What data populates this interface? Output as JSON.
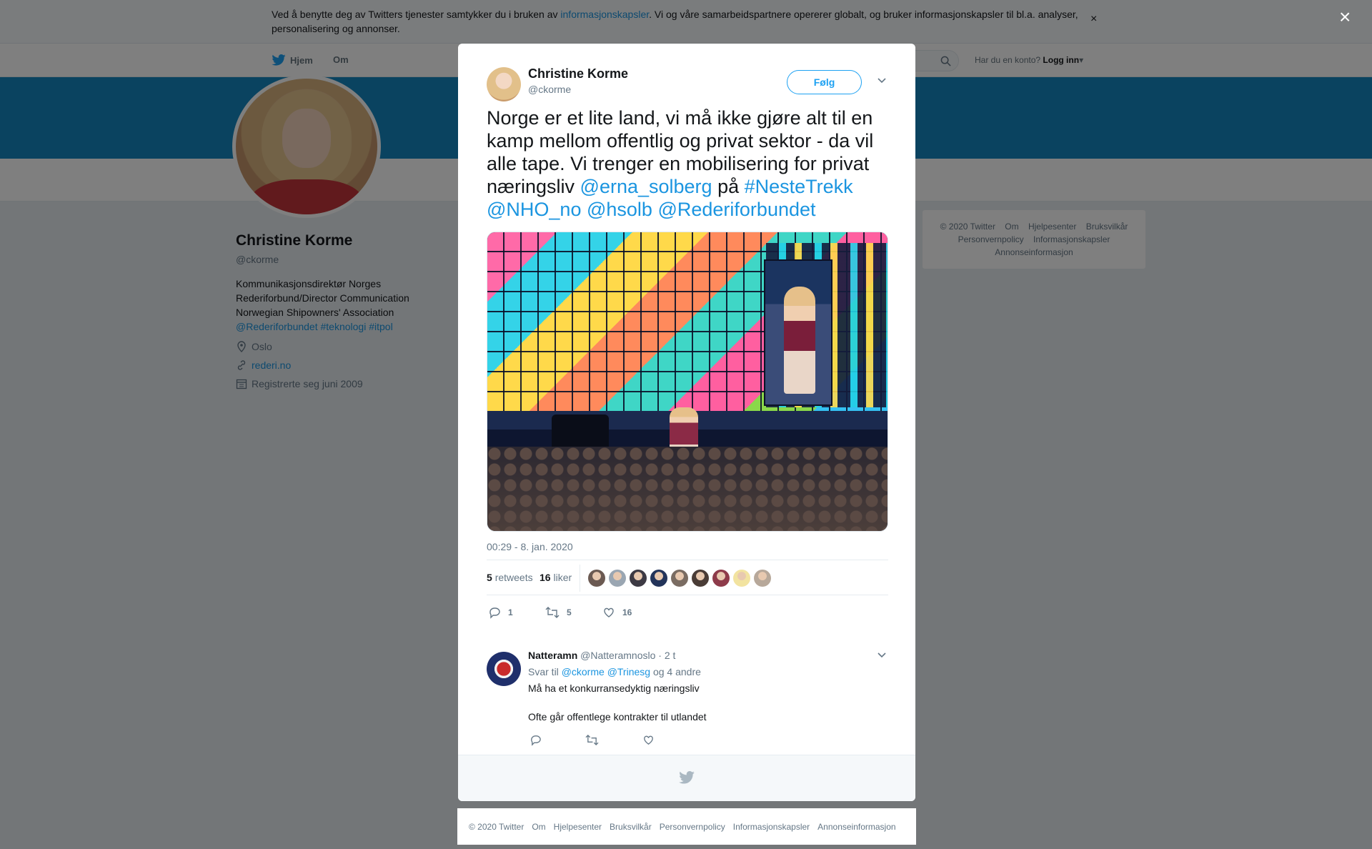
{
  "cookie": {
    "text_before": "Ved å benytte deg av Twitters tjenester samtykker du i bruken av ",
    "link": "informasjonskapsler",
    "text_after": ". Vi og våre samarbeidspartnere opererer globalt, og bruker informasjonskapsler til bl.a. analyser, personalisering og annonser.",
    "close": "×"
  },
  "nav": {
    "home": "Hjem",
    "about": "Om",
    "login_prompt": "Har du en konto?",
    "login": "Logg inn"
  },
  "profile": {
    "name": "Christine Korme",
    "handle": "@ckorme",
    "bio": "Kommunikasjonsdirektør Norges Rederiforbund/Director Communication Norwegian Shipowners' Association",
    "bio_links": "@Rederiforbundet #teknologi #itpol",
    "location": "Oslo",
    "website": "rederi.no",
    "joined": "Registrerte seg juni 2009"
  },
  "side_footer": {
    "line1": [
      "© 2020 Twitter",
      "Om",
      "Hjelpesenter",
      "Bruksvilkår"
    ],
    "line2": [
      "Personvernpolicy",
      "Informasjonskapsler"
    ],
    "line3": [
      "Annonseinformasjon"
    ]
  },
  "overlay_close": "×",
  "tweet": {
    "name": "Christine Korme",
    "handle": "@ckorme",
    "follow": "Følg",
    "text_plain": "Norge er et lite land, vi må ikke gjøre alt til en kamp mellom offentlig og privat sektor - da vil alle tape. Vi trenger en mobilisering for privat næringsliv ",
    "mention1": "@erna_solberg",
    "text_pa": " på ",
    "hashtag": "#NesteTrekk",
    "mention2": "@NHO_no",
    "mention3": "@hsolb",
    "mention4": "@Rederiforbundet",
    "timestamp": "00:29 - 8. jan. 2020",
    "retweets_count": "5",
    "retweets_label": "retweets",
    "likes_count": "16",
    "likes_label": "liker",
    "reply_count": "1",
    "retweet_count": "5",
    "like_count": "16"
  },
  "likers": [
    "#6b5a52",
    "#9aa6b2",
    "#3d3a44",
    "#23345a",
    "#7a6c62",
    "#4a3c36",
    "#8e3b4a",
    "#f2e3a0",
    "#b7a89a"
  ],
  "reply": {
    "name": "Natteramn",
    "handle": "@Natteramnoslo",
    "time": "· 2 t",
    "reply_to_label": "Svar til",
    "reply_to_1": "@ckorme",
    "reply_to_2": "@Trinesg",
    "reply_to_more": "og 4 andre",
    "line1": "Må ha et konkurransedyktig næringsliv",
    "line2": "Ofte går offentlege kontrakter til utlandet"
  },
  "footer": [
    "© 2020 Twitter",
    "Om",
    "Hjelpesenter",
    "Bruksvilkår",
    "Personvernpolicy",
    "Informasjonskapsler",
    "Annonseinformasjon"
  ]
}
